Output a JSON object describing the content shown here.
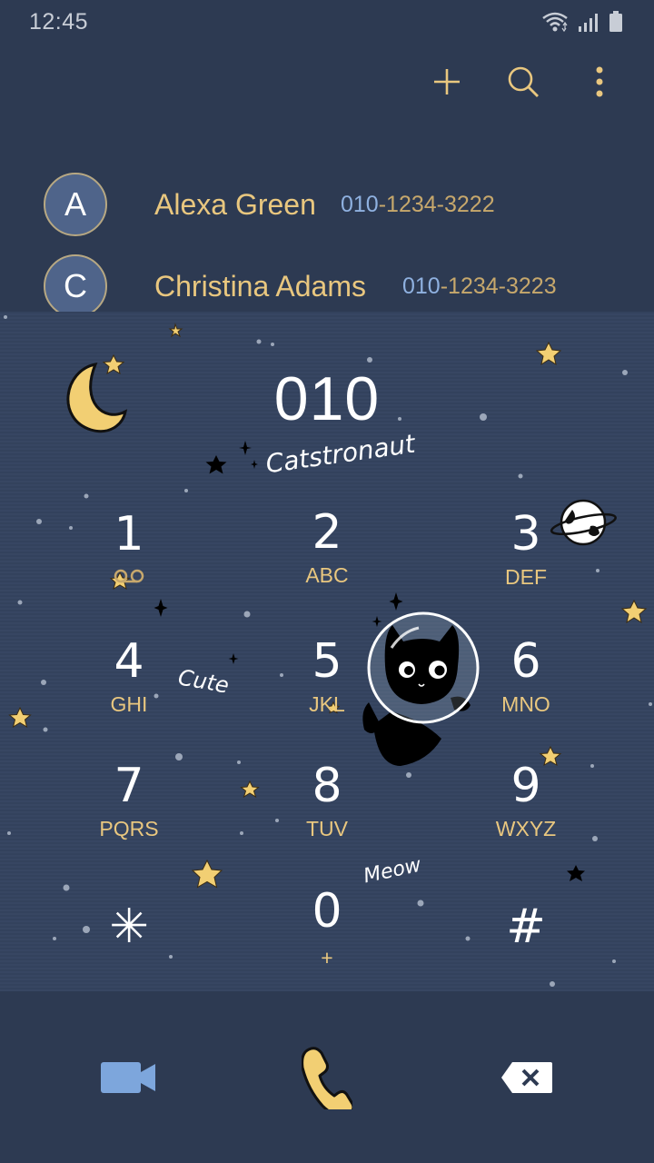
{
  "status_bar": {
    "time": "12:45",
    "icons": [
      "wifi-icon",
      "signal-icon",
      "battery-icon"
    ]
  },
  "action_bar": {
    "icons": [
      "add-icon",
      "search-icon",
      "more-icon"
    ]
  },
  "contacts": [
    {
      "initial": "A",
      "name": "Alexa Green",
      "number_match": "010",
      "number_rest": "-1234-3222"
    },
    {
      "initial": "C",
      "name": "Christina Adams",
      "number_match": "010",
      "number_rest": "-1234-3223"
    }
  ],
  "dialer": {
    "entered_number": "010",
    "theme_text": {
      "title": "Catstronaut",
      "cute": "Cute",
      "meow": "Meow"
    },
    "keys": [
      {
        "digit": "1",
        "letters": ""
      },
      {
        "digit": "2",
        "letters": "ABC"
      },
      {
        "digit": "3",
        "letters": "DEF"
      },
      {
        "digit": "4",
        "letters": "GHI"
      },
      {
        "digit": "5",
        "letters": "JKL"
      },
      {
        "digit": "6",
        "letters": "MNO"
      },
      {
        "digit": "7",
        "letters": "PQRS"
      },
      {
        "digit": "8",
        "letters": "TUV"
      },
      {
        "digit": "9",
        "letters": "WXYZ"
      },
      {
        "digit": "✳",
        "letters": ""
      },
      {
        "digit": "0",
        "letters": "+"
      },
      {
        "digit": "#",
        "letters": ""
      }
    ]
  },
  "bottom_bar": {
    "icons": [
      "video-call-icon",
      "call-icon",
      "backspace-icon"
    ]
  },
  "colors": {
    "background": "#2d3a52",
    "keypad_bg": "#34435f",
    "accent_gold": "#e9c77f",
    "match_blue": "#8fb1e0",
    "avatar_bg": "#4f648a"
  }
}
